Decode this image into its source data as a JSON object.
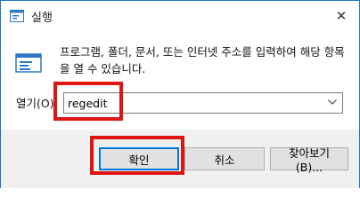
{
  "window": {
    "title": "실행",
    "close_glyph": "✕"
  },
  "prompt": {
    "text": "프로그램, 폴더, 문서, 또는 인터넷 주소를 입력하여 해당 항목을 열 수 있습니다."
  },
  "open_field": {
    "label": "열기(O):",
    "value": "regedit"
  },
  "buttons": {
    "ok": "확인",
    "cancel": "취소",
    "browse": "찾아보기(B)..."
  },
  "colors": {
    "window_border": "#1a73c7",
    "footer_bg": "#f0f0f0",
    "highlight": "#e11414",
    "default_button_border": "#0078d7"
  },
  "icons": {
    "app": "run-window-icon",
    "close": "close-icon",
    "dropdown": "chevron-down-icon",
    "run": "run-dialog-icon"
  }
}
